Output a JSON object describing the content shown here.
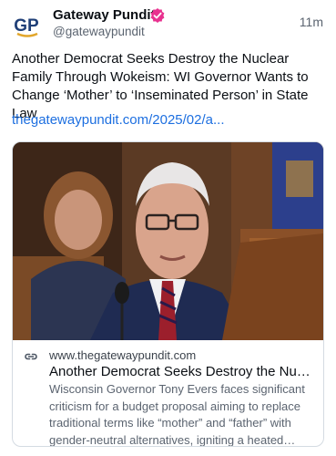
{
  "post": {
    "author": {
      "name": "Gateway Pundit",
      "handle": "@gatewaypundit",
      "avatar_text": "GP",
      "verified_color": "#e8318f"
    },
    "timestamp": "11m",
    "text": "Another Democrat Seeks Destroy the Nuclear Family Through Wokeism: WI Governor Wants to Change ‘Mother’ to ‘Inseminated Person’ in State Law",
    "link": "thegatewaypundit.com/2025/02/a...",
    "link_color": "#1d6fe0"
  },
  "card": {
    "image": "photo-of-governor-speaking-at-podium",
    "icon": "globe-icon",
    "domain": "www.thegatewaypundit.com",
    "title": "Another Democrat Seeks Destroy the Nuclear Family Through Wokeism: WI Governor Wants to Change ‘Mother’ to ‘Inseminated Person’ in State Law",
    "description": "Wisconsin Governor Tony Evers faces significant criticism for a budget proposal aiming to replace traditional terms like “mother” and “father” with gender-neutral alternatives, igniting a heated debate over parental rights and traditional family values."
  }
}
